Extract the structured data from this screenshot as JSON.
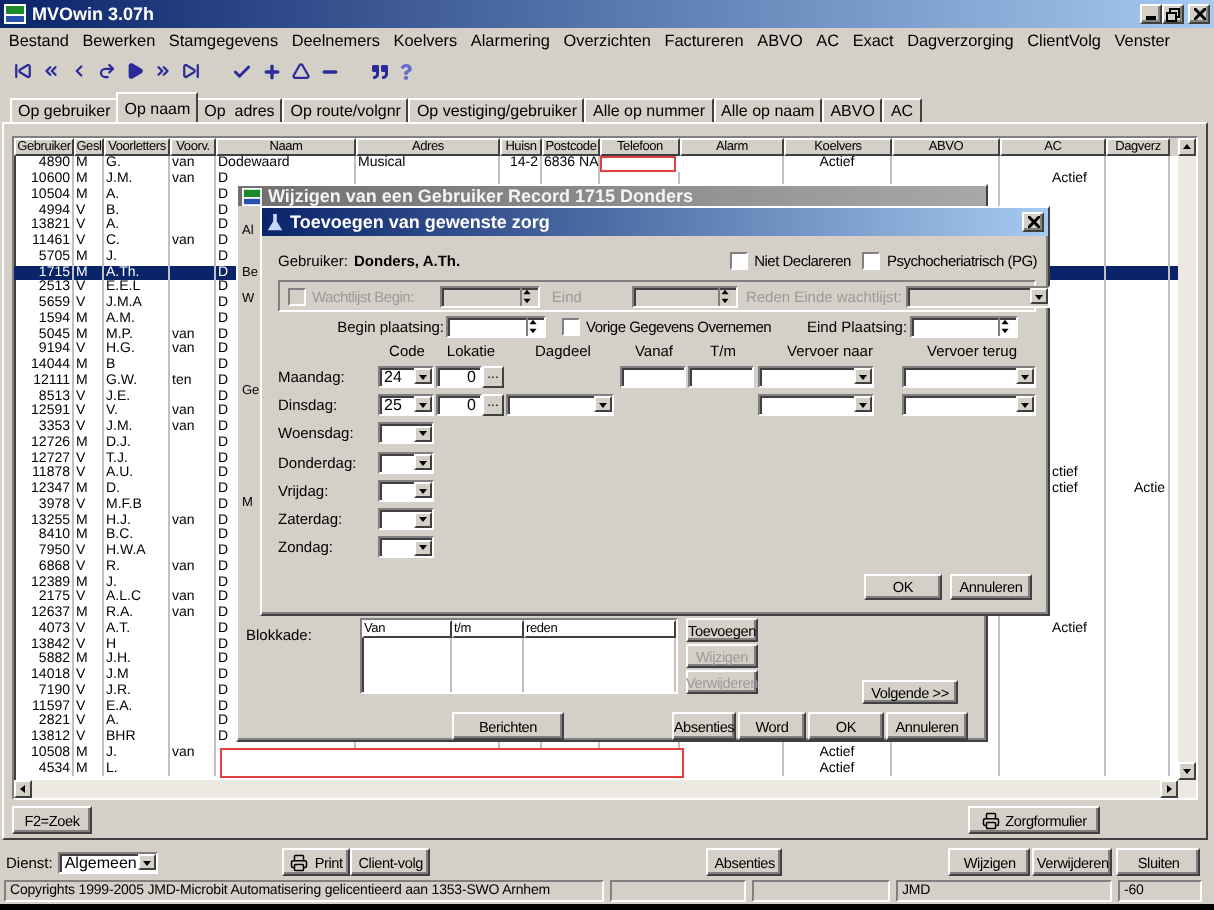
{
  "window": {
    "title": "MVOwin 3.07h"
  },
  "menu": [
    "Bestand",
    "Bewerken",
    "Stamgegevens",
    "Deelnemers",
    "Koelvers",
    "Alarmering",
    "Overzichten",
    "Factureren",
    "ABVO",
    "AC",
    "Exact",
    "Dagverzorging",
    "ClientVolg",
    "Venster"
  ],
  "tabs": [
    {
      "label": "Op gebruiker",
      "selected": false
    },
    {
      "label": "Op naam",
      "selected": true
    },
    {
      "label": "Op  adres",
      "selected": false
    },
    {
      "label": "Op route/volgnr",
      "selected": false
    },
    {
      "label": "Op vestiging/gebruiker",
      "selected": false
    },
    {
      "label": "Alle op nummer",
      "selected": false
    },
    {
      "label": "Alle op naam",
      "selected": false
    },
    {
      "label": "ABVO",
      "selected": false
    },
    {
      "label": "AC",
      "selected": false
    }
  ],
  "table": {
    "columns": [
      "Gebruiker",
      "Gesl",
      "Voorletters",
      "Voorv.",
      "Naam",
      "Adres",
      "Huisn",
      "Postcode",
      "Telefoon",
      "Alarm",
      "Koelvers",
      "ABVO",
      "AC",
      "Dagverz"
    ],
    "rows": [
      {
        "gebruiker": "4890",
        "gesl": "M",
        "voorletters": "G.",
        "voorv": "van",
        "naam": "Dodewaard",
        "adres": "Musical",
        "huisnr": "14-2",
        "postcode": "6836 NA",
        "koelvers": "Actief",
        "selected": false
      },
      {
        "gebruiker": "10600",
        "gesl": "M",
        "voorletters": "J.M.",
        "voorv": "van",
        "naam": "D",
        "ac": "Actief",
        "selected": false
      },
      {
        "gebruiker": "10504",
        "gesl": "M",
        "voorletters": "A.",
        "naam": "D",
        "selected": false
      },
      {
        "gebruiker": "4994",
        "gesl": "V",
        "voorletters": "B.",
        "naam": "D",
        "selected": false
      },
      {
        "gebruiker": "13821",
        "gesl": "V",
        "voorletters": "A.",
        "naam": "D",
        "selected": false
      },
      {
        "gebruiker": "11461",
        "gesl": "V",
        "voorletters": "C.",
        "voorv": "van",
        "naam": "D",
        "selected": false
      },
      {
        "gebruiker": "5705",
        "gesl": "M",
        "voorletters": "J.",
        "naam": "D",
        "selected": false
      },
      {
        "gebruiker": "1715",
        "gesl": "M",
        "voorletters": "A.Th.",
        "naam": "D",
        "selected": true
      },
      {
        "gebruiker": "2513",
        "gesl": "V",
        "voorletters": "E.E.L",
        "naam": "D",
        "selected": false
      },
      {
        "gebruiker": "5659",
        "gesl": "V",
        "voorletters": "J.M.A",
        "naam": "D",
        "selected": false
      },
      {
        "gebruiker": "1594",
        "gesl": "M",
        "voorletters": "A.M.",
        "naam": "D",
        "selected": false
      },
      {
        "gebruiker": "5045",
        "gesl": "M",
        "voorletters": "M.P.",
        "voorv": "van",
        "naam": "D",
        "selected": false
      },
      {
        "gebruiker": "9194",
        "gesl": "V",
        "voorletters": "H.G.",
        "voorv": "van",
        "naam": "D",
        "selected": false
      },
      {
        "gebruiker": "14044",
        "gesl": "M",
        "voorletters": "B",
        "naam": "D",
        "selected": false
      },
      {
        "gebruiker": "12111",
        "gesl": "M",
        "voorletters": "G.W.",
        "voorv": "ten",
        "naam": "D",
        "selected": false
      },
      {
        "gebruiker": "8513",
        "gesl": "V",
        "voorletters": "J.E.",
        "naam": "D",
        "selected": false
      },
      {
        "gebruiker": "12591",
        "gesl": "V",
        "voorletters": "V.",
        "voorv": "van",
        "naam": "D",
        "selected": false
      },
      {
        "gebruiker": "3353",
        "gesl": "V",
        "voorletters": "J.M.",
        "voorv": "van",
        "naam": "D",
        "selected": false
      },
      {
        "gebruiker": "12726",
        "gesl": "M",
        "voorletters": "D.J.",
        "naam": "D",
        "selected": false
      },
      {
        "gebruiker": "12727",
        "gesl": "V",
        "voorletters": "T.J.",
        "naam": "D",
        "selected": false
      },
      {
        "gebruiker": "11878",
        "gesl": "V",
        "voorletters": "A.U.",
        "naam": "D",
        "ac": "ctief",
        "selected": false
      },
      {
        "gebruiker": "12347",
        "gesl": "M",
        "voorletters": "D.",
        "naam": "D",
        "ac": "ctief",
        "dagverz": "Actie",
        "selected": false
      },
      {
        "gebruiker": "3978",
        "gesl": "V",
        "voorletters": "M.F.B",
        "naam": "D",
        "selected": false
      },
      {
        "gebruiker": "13255",
        "gesl": "M",
        "voorletters": "H.J.",
        "voorv": "van",
        "naam": "D",
        "selected": false
      },
      {
        "gebruiker": "8410",
        "gesl": "M",
        "voorletters": "B.C.",
        "naam": "D",
        "selected": false
      },
      {
        "gebruiker": "7950",
        "gesl": "V",
        "voorletters": "H.W.A",
        "naam": "D",
        "selected": false
      },
      {
        "gebruiker": "6868",
        "gesl": "V",
        "voorletters": "R.",
        "voorv": "van",
        "naam": "D",
        "selected": false
      },
      {
        "gebruiker": "12389",
        "gesl": "M",
        "voorletters": "J.",
        "naam": "D",
        "selected": false
      },
      {
        "gebruiker": "2175",
        "gesl": "V",
        "voorletters": "A.L.C",
        "voorv": "van",
        "naam": "D",
        "selected": false
      },
      {
        "gebruiker": "12637",
        "gesl": "M",
        "voorletters": "R.A.",
        "voorv": "van",
        "naam": "D",
        "selected": false
      },
      {
        "gebruiker": "4073",
        "gesl": "V",
        "voorletters": "A.T.",
        "naam": "D",
        "ac": "Actief",
        "selected": false
      },
      {
        "gebruiker": "13842",
        "gesl": "V",
        "voorletters": "H",
        "naam": "D",
        "selected": false
      },
      {
        "gebruiker": "5882",
        "gesl": "M",
        "voorletters": "J.H.",
        "naam": "D",
        "selected": false
      },
      {
        "gebruiker": "14018",
        "gesl": "V",
        "voorletters": "J.M",
        "naam": "D",
        "selected": false
      },
      {
        "gebruiker": "7190",
        "gesl": "V",
        "voorletters": "J.R.",
        "naam": "D",
        "selected": false
      },
      {
        "gebruiker": "11597",
        "gesl": "V",
        "voorletters": "E.A.",
        "naam": "D",
        "selected": false
      },
      {
        "gebruiker": "2821",
        "gesl": "V",
        "voorletters": "A.",
        "naam": "D",
        "selected": false
      },
      {
        "gebruiker": "13812",
        "gesl": "V",
        "voorletters": "BHR",
        "naam": "D",
        "selected": false
      },
      {
        "gebruiker": "10508",
        "gesl": "M",
        "voorletters": "J.",
        "voorv": "van",
        "koelvers": "Actief",
        "selected": false
      },
      {
        "gebruiker": "4534",
        "gesl": "M",
        "voorletters": "L.",
        "koelvers": "Actief",
        "selected": false
      }
    ]
  },
  "search_button": "F2=Zoek",
  "form_button": "Zorgformulier",
  "bottom_bar": {
    "dienst_label": "Dienst:",
    "dienst_value": "Algemeen",
    "print": "Print",
    "client_volg": "Client-volg",
    "absenties": "Absenties",
    "wijzigen": "Wijzigen",
    "verwijderen": "Verwijderen",
    "sluiten": "Sluiten"
  },
  "status_bar": {
    "copyright": "Copyrights 1999-2005 JMD-Microbit Automatisering gelicentieerd aan 1353-SWO Arnhem",
    "user": "JMD",
    "value": "-60"
  },
  "edit_dialog": {
    "title": "Wijzigen van een Gebruiker Record 1715 Donders",
    "side_labels": [
      "Al",
      "Be",
      "W",
      "Ge",
      "M"
    ],
    "blokkade_label": "Blokkade:",
    "blokkade_columns": [
      "Van",
      "t/m",
      "reden"
    ],
    "blokkade_buttons": [
      {
        "label": "Toevoegen",
        "disabled": false
      },
      {
        "label": "Wijzigen",
        "disabled": true
      },
      {
        "label": "Verwijderen",
        "disabled": true
      }
    ],
    "next_button": "Volgende >>",
    "berichten": "Berichten",
    "buttons": [
      "Absenties",
      "Word",
      "OK",
      "Annuleren"
    ]
  },
  "care_dialog": {
    "title": "Toevoegen van gewenste zorg",
    "user_label": "Gebruiker:",
    "user_name": "Donders, A.Th.",
    "niet_declareren": {
      "label": "Niet Declareren",
      "checked": false
    },
    "psycho": {
      "label": "Psychocheriatrisch (PG)",
      "checked": false
    },
    "waitlist": {
      "label": "Wachtlijst Begin:",
      "checked": false,
      "disabled": true,
      "end_label": "Eind",
      "reason_label": "Reden Einde wachtlijst:"
    },
    "begin_label": "Begin plaatsing:",
    "copy_previous": {
      "label": "Vorige Gegevens Overnemen",
      "checked": false
    },
    "end_label": "Eind Plaatsing:",
    "columns": [
      "Code",
      "Lokatie",
      "Dagdeel",
      "Vanaf",
      "T/m",
      "Vervoer naar",
      "Vervoer terug"
    ],
    "days": [
      {
        "label": "Maandag:",
        "kind": "times",
        "code": "24",
        "lokatie": "0",
        "browse": "..."
      },
      {
        "label": "Dinsdag:",
        "kind": "dagdeel",
        "code": "25",
        "lokatie": "0",
        "browse": "..."
      },
      {
        "label": "Woensdag:",
        "kind": "code"
      },
      {
        "label": "Donderdag:",
        "kind": "code"
      },
      {
        "label": "Vrijdag:",
        "kind": "code"
      },
      {
        "label": "Zaterdag:",
        "kind": "code"
      },
      {
        "label": "Zondag:",
        "kind": "code"
      }
    ],
    "buttons": [
      "OK",
      "Annuleren"
    ]
  }
}
